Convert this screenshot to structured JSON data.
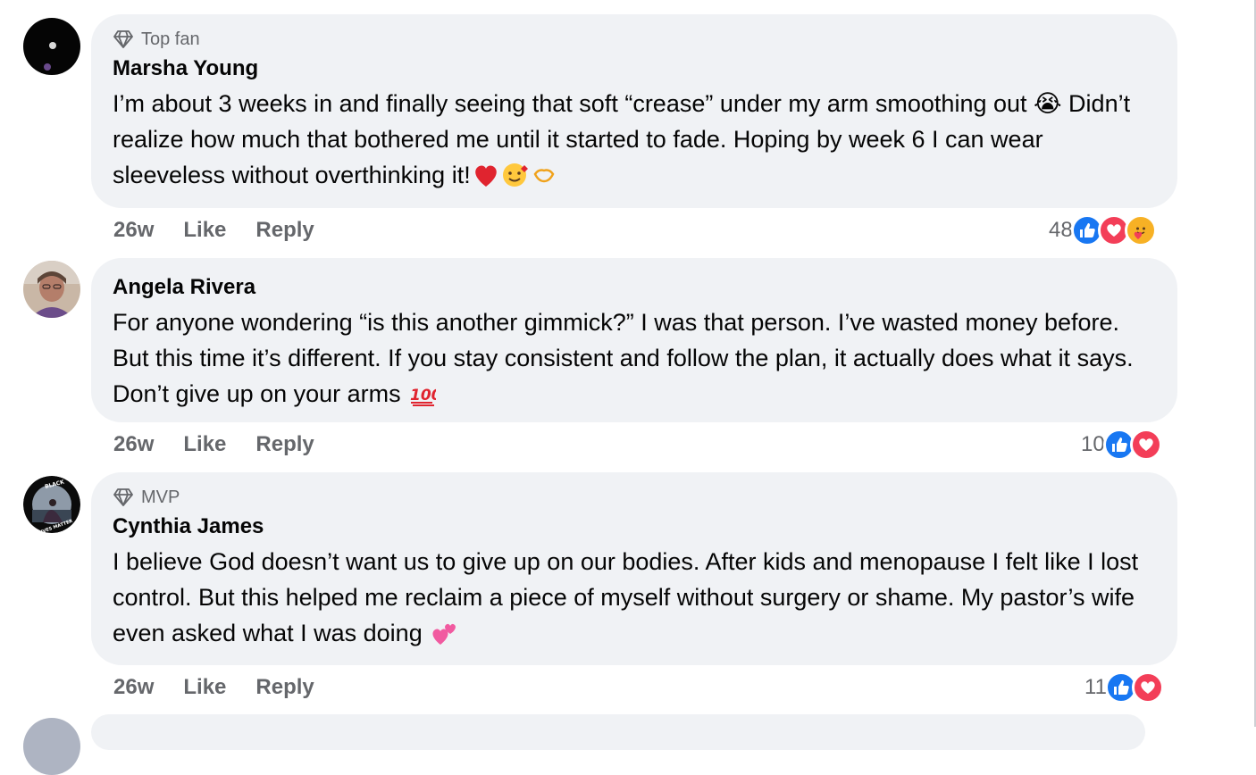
{
  "comments": [
    {
      "badge": "Top fan",
      "author": "Marsha Young",
      "text": "I’m about 3 weeks in and finally seeing that soft “crease” under my arm smoothing out 😭 Didn’t realize how much that bothered me until it started to fade. Hoping by week 6 I can wear sleeveless without overthinking it!",
      "trailing_emoji": "❤️🥰🫶",
      "time": "26w",
      "like_label": "Like",
      "reply_label": "Reply",
      "reaction_count": "48",
      "reactions": [
        "like",
        "love",
        "care"
      ]
    },
    {
      "badge": "",
      "author": "Angela Rivera",
      "text": "For anyone wondering “is this another gimmick?” I was that person. I’ve wasted money before. But this time it’s different. If you stay consistent and follow the plan, it actually does what it says. Don’t give up on your arms",
      "trailing_emoji": "💯",
      "time": "26w",
      "like_label": "Like",
      "reply_label": "Reply",
      "reaction_count": "10",
      "reactions": [
        "like",
        "love"
      ]
    },
    {
      "badge": "MVP",
      "author": "Cynthia James",
      "text": "I believe God doesn’t want us to give up on our bodies. After kids and menopause I felt like I lost control. But this helped me reclaim a piece of myself without surgery or shame. My pastor’s wife even asked what I was doing",
      "trailing_emoji": "💕",
      "time": "26w",
      "like_label": "Like",
      "reply_label": "Reply",
      "reaction_count": "11",
      "reactions": [
        "like",
        "love"
      ]
    }
  ],
  "colors": {
    "bubble": "#f0f2f5",
    "secondary_text": "#65676b",
    "like_blue": "#1877f2",
    "love_red": "#f33e58",
    "care_yellow": "#f7b125"
  },
  "icons": {
    "badge": "diamond-icon",
    "like": "thumbs-up-icon",
    "love": "heart-icon",
    "care": "care-hug-icon"
  }
}
